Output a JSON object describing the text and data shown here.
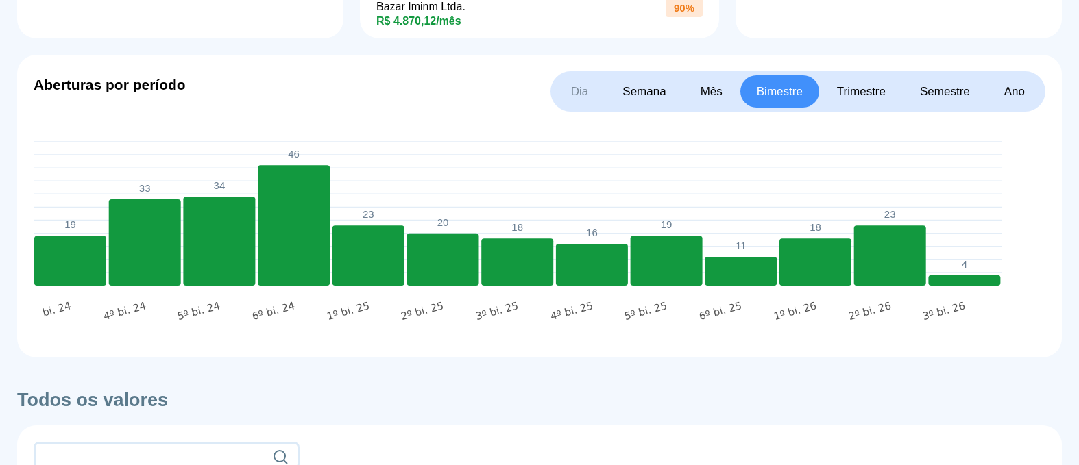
{
  "top_cards": [
    {
      "company": "Bazar Iminm Ltda.",
      "amount": "R$ 4.870,12/mês",
      "badge": "90%"
    }
  ],
  "chart_card": {
    "title": "Aberturas por período",
    "periods": [
      {
        "label": "Dia",
        "selected": false,
        "disabled": true
      },
      {
        "label": "Semana",
        "selected": false,
        "disabled": false
      },
      {
        "label": "Mês",
        "selected": false,
        "disabled": false
      },
      {
        "label": "Bimestre",
        "selected": true,
        "disabled": false
      },
      {
        "label": "Trimestre",
        "selected": false,
        "disabled": false
      },
      {
        "label": "Semestre",
        "selected": false,
        "disabled": false
      },
      {
        "label": "Ano",
        "selected": false,
        "disabled": false
      }
    ],
    "chart_data": {
      "type": "bar",
      "categories": [
        "bi. 24",
        "4º bi. 24",
        "5º bi. 24",
        "6º bi. 24",
        "1º bi. 25",
        "2º bi. 25",
        "3º bi. 25",
        "4º bi. 25",
        "5º bi. 25",
        "6º bi. 25",
        "1º bi. 26",
        "2º bi. 26",
        "3º bi. 26"
      ],
      "series": [
        {
          "color": "#12993f",
          "values": [
            19,
            33,
            34,
            46,
            23,
            20,
            18,
            16,
            19,
            11,
            18,
            23,
            4
          ]
        }
      ],
      "ylim": [
        0,
        55
      ],
      "data_labels": true
    }
  },
  "all_values": {
    "title": "Todos os valores"
  }
}
